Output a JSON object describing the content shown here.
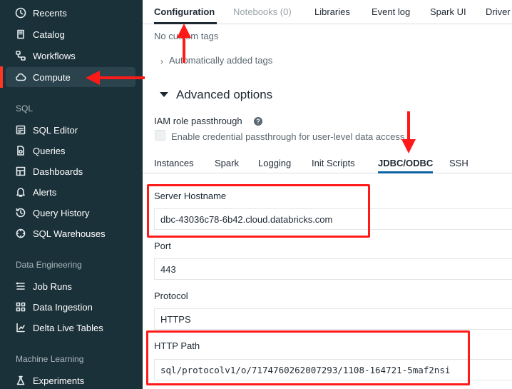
{
  "sidebar": {
    "items": [
      {
        "label": "Recents",
        "icon": "clock-icon"
      },
      {
        "label": "Catalog",
        "icon": "catalog-icon"
      },
      {
        "label": "Workflows",
        "icon": "workflows-icon"
      },
      {
        "label": "Compute",
        "icon": "cloud-icon",
        "active": true
      },
      {
        "label": "SQL Editor",
        "icon": "sql-editor-icon"
      },
      {
        "label": "Queries",
        "icon": "queries-icon"
      },
      {
        "label": "Dashboards",
        "icon": "dashboards-icon"
      },
      {
        "label": "Alerts",
        "icon": "bell-icon"
      },
      {
        "label": "Query History",
        "icon": "history-icon"
      },
      {
        "label": "SQL Warehouses",
        "icon": "warehouse-icon"
      },
      {
        "label": "Job Runs",
        "icon": "job-runs-icon"
      },
      {
        "label": "Data Ingestion",
        "icon": "ingestion-icon"
      },
      {
        "label": "Delta Live Tables",
        "icon": "dlt-icon"
      },
      {
        "label": "Experiments",
        "icon": "flask-icon"
      }
    ],
    "sections": {
      "sql": "SQL",
      "data_engineering": "Data Engineering",
      "machine_learning": "Machine Learning"
    }
  },
  "top_tabs": [
    {
      "label": "Configuration",
      "active": true
    },
    {
      "label": "Notebooks (0)",
      "muted": true
    },
    {
      "label": "Libraries"
    },
    {
      "label": "Event log"
    },
    {
      "label": "Spark UI"
    },
    {
      "label": "Driver"
    }
  ],
  "config": {
    "custom_tags_partial": "No custom tags",
    "auto_tags": "Automatically added tags",
    "advanced_options": "Advanced options",
    "iam_title": "IAM role passthrough",
    "iam_checkbox": "Enable credential passthrough for user-level data access"
  },
  "sub_tabs": [
    {
      "label": "Instances"
    },
    {
      "label": "Spark"
    },
    {
      "label": "Logging"
    },
    {
      "label": "Init Scripts"
    },
    {
      "label": "JDBC/ODBC",
      "active": true
    },
    {
      "label": "SSH"
    }
  ],
  "fields": {
    "server_hostname": {
      "label": "Server Hostname",
      "value": "dbc-43036c78-6b42.cloud.databricks.com"
    },
    "port": {
      "label": "Port",
      "value": "443"
    },
    "protocol": {
      "label": "Protocol",
      "value": "HTTPS"
    },
    "http_path": {
      "label": "HTTP Path",
      "value": "sql/protocolv1/o/7174760262007293/1108-164721-5maf2nsi"
    }
  },
  "colors": {
    "sidebar_bg": "#1b3139",
    "annotation_red": "#ff1a1a",
    "active_tab_underline": "#0b62a4"
  }
}
